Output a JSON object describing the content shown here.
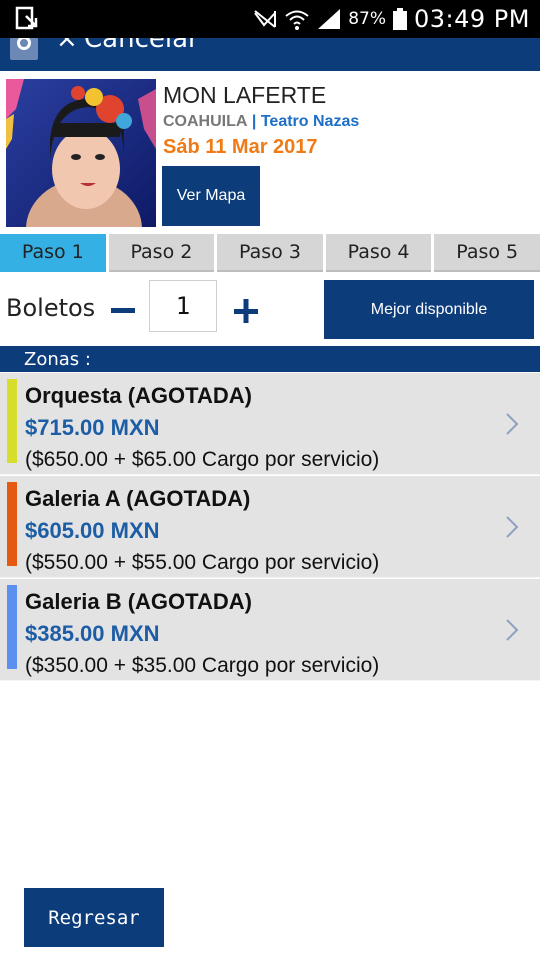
{
  "status_bar": {
    "battery_percent": "87%",
    "time": "03:49 PM",
    "icons": [
      "download-icon",
      "mute-icon",
      "wifi-icon",
      "signal-icon",
      "battery-icon"
    ]
  },
  "nav": {
    "cancel_label": "Cancelar",
    "close_glyph": "×",
    "icons": [
      "app-logo-icon",
      "close-icon"
    ]
  },
  "event": {
    "title": "MON LAFERTE",
    "state": "COAHUILA",
    "separator": "|",
    "venue": "Teatro Nazas",
    "date": "Sáb 11 Mar 2017",
    "map_button": "Ver Mapa"
  },
  "steps": [
    {
      "label": "Paso 1",
      "active": true
    },
    {
      "label": "Paso 2",
      "active": false
    },
    {
      "label": "Paso 3",
      "active": false
    },
    {
      "label": "Paso 4",
      "active": false
    },
    {
      "label": "Paso 5",
      "active": false
    }
  ],
  "tickets": {
    "label": "Boletos",
    "quantity": "1",
    "best_button": "Mejor disponible"
  },
  "zones_label": "Zonas :",
  "zones": [
    {
      "name": "Orquesta (AGOTADA)",
      "price": "$715.00 MXN",
      "breakdown": "($650.00 + $65.00 Cargo por servicio)",
      "color": "#d6dd2c"
    },
    {
      "name": "Galeria A (AGOTADA)",
      "price": "$605.00 MXN",
      "breakdown": "($550.00 + $55.00 Cargo por servicio)",
      "color": "#e45a12"
    },
    {
      "name": "Galeria B (AGOTADA)",
      "price": "$385.00 MXN",
      "breakdown": "($350.00 + $35.00 Cargo por servicio)",
      "color": "#5b8ff0"
    }
  ],
  "back_button": "Regresar",
  "colors": {
    "primary": "#0d3c7a",
    "active_step": "#35b0e4",
    "price": "#1d5da6",
    "date": "#f07b16",
    "venue": "#1d6fc7"
  }
}
